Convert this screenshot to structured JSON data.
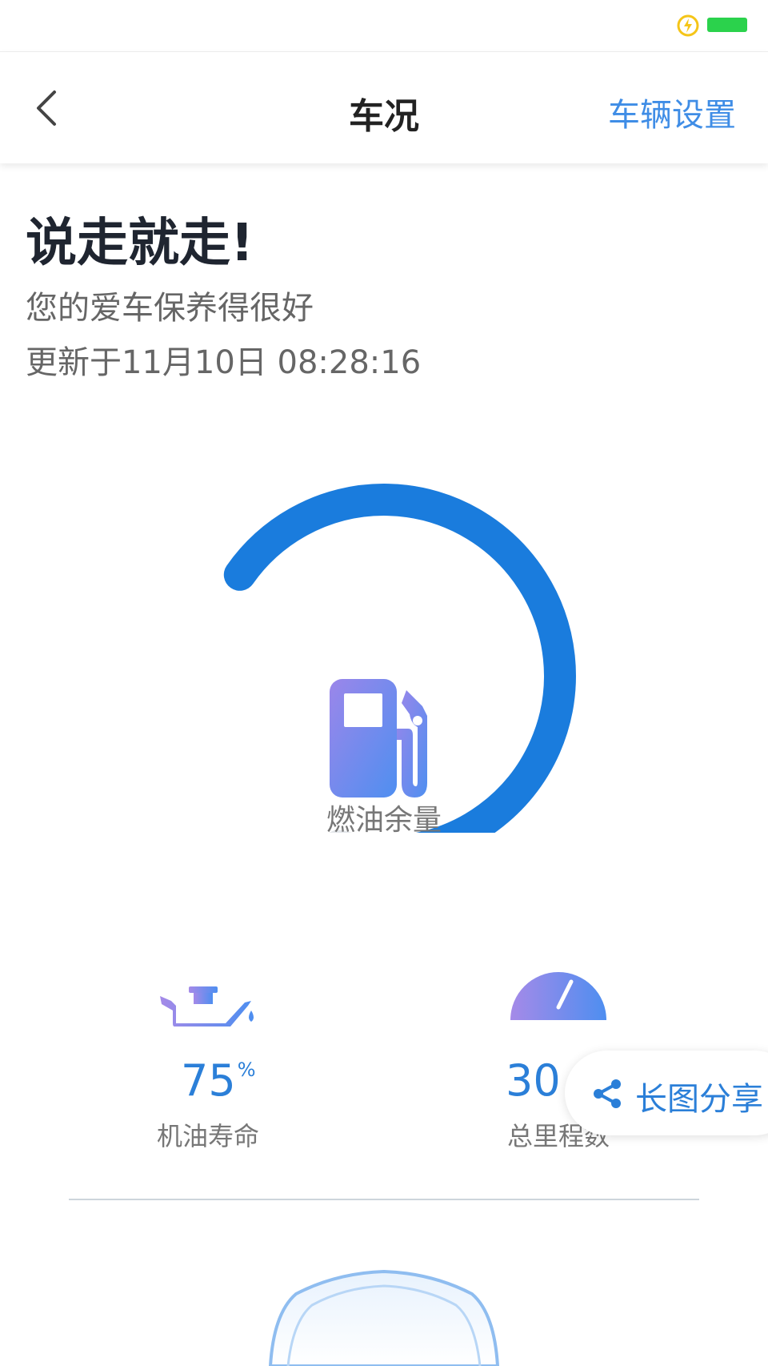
{
  "nav": {
    "title": "车况",
    "settings_label": "车辆设置",
    "back_icon": "chevron-left-icon"
  },
  "status_bar": {
    "charging_icon": "lightning-icon",
    "battery_color": "#2bd24c"
  },
  "header": {
    "headline": "说走就走!",
    "subtitle": "您的爱车保养得很好",
    "updated": "更新于11月10日 08:28:16"
  },
  "fuel_gauge": {
    "label": "燃油余量",
    "level_fraction": 0.9,
    "icon": "fuel-pump-icon",
    "track_color": "#e3e6ea",
    "fill_color": "#1a7cdd"
  },
  "stats": {
    "oil_life": {
      "value": "75",
      "unit": "%",
      "label": "机油寿命",
      "icon": "oil-can-icon"
    },
    "odometer": {
      "value": "30",
      "label": "总里程数",
      "icon": "speedometer-icon"
    }
  },
  "share": {
    "label": "长图分享",
    "icon": "share-icon"
  },
  "colors": {
    "accent": "#2b7fd8",
    "link": "#3f8de6"
  }
}
